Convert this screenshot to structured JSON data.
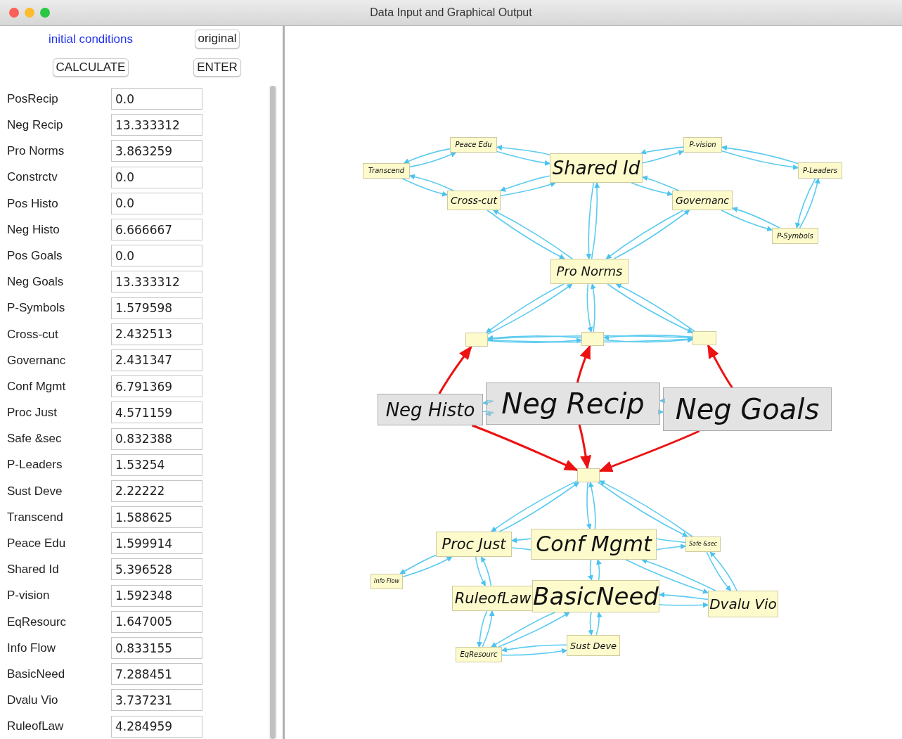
{
  "window": {
    "title": "Data Input and Graphical Output"
  },
  "header": {
    "link": "initial conditions",
    "buttons": [
      "original",
      "CALCULATE",
      "ENTER"
    ]
  },
  "fields": [
    {
      "label": "PosRecip",
      "value": "0.0"
    },
    {
      "label": "Neg Recip",
      "value": "13.333312"
    },
    {
      "label": "Pro Norms",
      "value": "3.863259"
    },
    {
      "label": "Constrctv",
      "value": "0.0"
    },
    {
      "label": "Pos Histo",
      "value": "0.0"
    },
    {
      "label": "Neg Histo",
      "value": "6.666667"
    },
    {
      "label": "Pos Goals",
      "value": "0.0"
    },
    {
      "label": "Neg Goals",
      "value": "13.333312"
    },
    {
      "label": "P-Symbols",
      "value": "1.579598"
    },
    {
      "label": "Cross-cut",
      "value": "2.432513"
    },
    {
      "label": "Governanc",
      "value": "2.431347"
    },
    {
      "label": "Conf Mgmt",
      "value": "6.791369"
    },
    {
      "label": "Proc Just",
      "value": "4.571159"
    },
    {
      "label": "Safe &sec",
      "value": "0.832388"
    },
    {
      "label": "P-Leaders",
      "value": "1.53254"
    },
    {
      "label": "Sust Deve",
      "value": "2.22222"
    },
    {
      "label": "Transcend",
      "value": "1.588625"
    },
    {
      "label": "Peace Edu",
      "value": "1.599914"
    },
    {
      "label": "Shared Id",
      "value": "5.396528"
    },
    {
      "label": "P-vision",
      "value": "1.592348"
    },
    {
      "label": "EqResourc",
      "value": "1.647005"
    },
    {
      "label": "Info Flow",
      "value": "0.833155"
    },
    {
      "label": "BasicNeed",
      "value": "7.288451"
    },
    {
      "label": "Dvalu Vio",
      "value": "3.737231"
    },
    {
      "label": "RuleofLaw",
      "value": "4.284959"
    }
  ],
  "graph": {
    "nodes": [
      {
        "kind": "node",
        "label": "Peace Edu"
      },
      {
        "kind": "node",
        "label": "P-vision"
      },
      {
        "kind": "node",
        "label": "Transcend"
      },
      {
        "kind": "node",
        "label": "Shared Id"
      },
      {
        "kind": "node",
        "label": "P-Leaders"
      },
      {
        "kind": "node",
        "label": "Cross-cut"
      },
      {
        "kind": "node",
        "label": "Governanc"
      },
      {
        "kind": "node",
        "label": "P-Symbols"
      },
      {
        "kind": "node",
        "label": "Pro Norms"
      },
      {
        "kind": "tiny"
      },
      {
        "kind": "tiny"
      },
      {
        "kind": "tiny"
      },
      {
        "kind": "grey",
        "label": "Neg Histo"
      },
      {
        "kind": "grey",
        "label": "Neg Recip"
      },
      {
        "kind": "grey",
        "label": "Neg Goals"
      },
      {
        "kind": "tiny"
      },
      {
        "kind": "node",
        "label": "Proc Just"
      },
      {
        "kind": "node",
        "label": "Conf Mgmt"
      },
      {
        "kind": "node",
        "label": "Safe &sec"
      },
      {
        "kind": "node",
        "label": "Info Flow"
      },
      {
        "kind": "node",
        "label": "RuleofLaw"
      },
      {
        "kind": "node",
        "label": "BasicNeed"
      },
      {
        "kind": "node",
        "label": "Dvalu Vio"
      },
      {
        "kind": "node",
        "label": "Sust Deve"
      },
      {
        "kind": "node",
        "label": "EqResourc"
      }
    ]
  }
}
